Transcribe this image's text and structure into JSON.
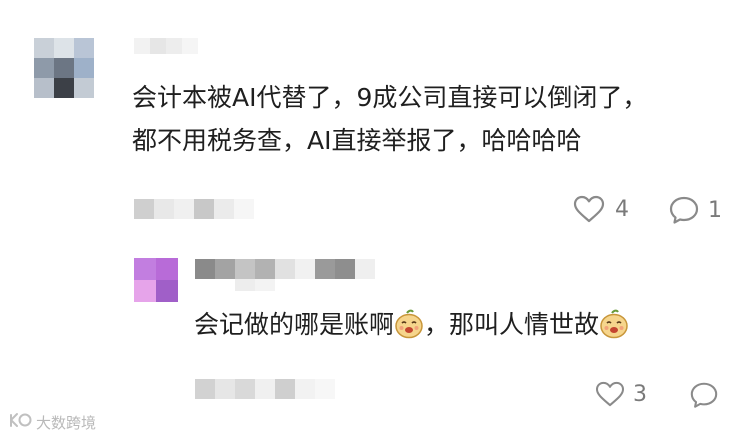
{
  "comments": [
    {
      "id": "top",
      "text_line1": "会计本被AI代替了，9成公司直接可以倒闭了，",
      "text_line2": "都不用税务查，AI直接举报了，哈哈哈哈",
      "likes": "4",
      "replies": "1"
    },
    {
      "id": "reply",
      "text_prefix": "会记做的哪是账啊",
      "text_middle": "，那叫人情世故",
      "likes": "3"
    }
  ],
  "watermark": {
    "text": "大数跨境"
  },
  "icons": {
    "like": "heart-icon",
    "reply": "speech-bubble-icon",
    "emoji": "laughing-face-emoji",
    "watermark": "brand-logo-icon"
  },
  "colors": {
    "icon": "#8a8a8a",
    "text": "#1f1f1f",
    "meta": "#7a7a7a"
  }
}
